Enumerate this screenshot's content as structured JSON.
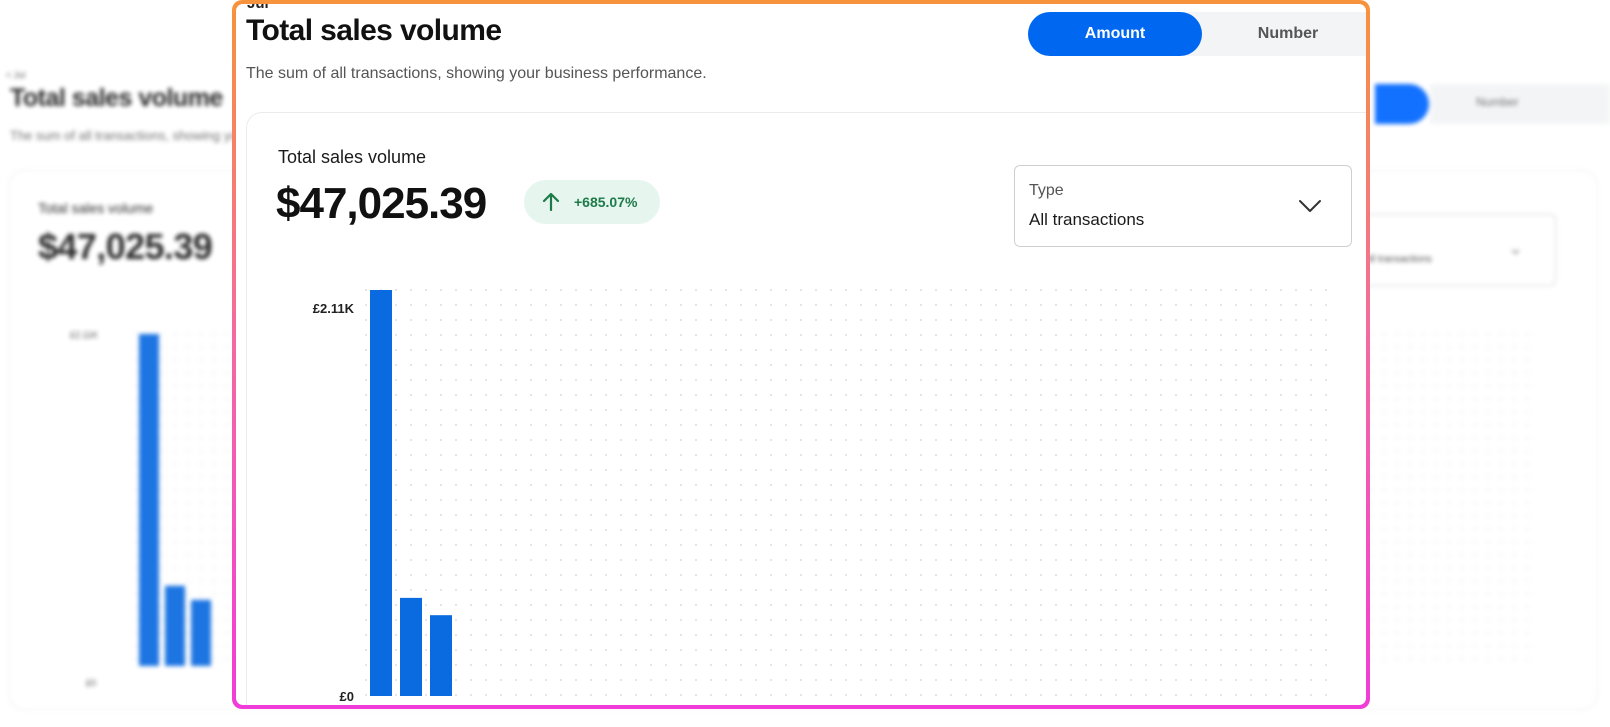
{
  "header": {
    "crumb_fragment": "Jul",
    "title": "Total sales volume",
    "subtitle": "The sum of all transactions, showing your business performance."
  },
  "toggle": {
    "amount_label": "Amount",
    "number_label": "Number",
    "selected": "Amount"
  },
  "summary": {
    "label": "Total sales volume",
    "total": "$47,025.39",
    "change": "+685.07%",
    "change_icon": "arrow-up-icon"
  },
  "type_filter": {
    "label": "Type",
    "value": "All transactions",
    "icon": "chevron-down-icon"
  },
  "background": {
    "crumb": "< Jul",
    "title": "Total sales volume",
    "subtitle": "The sum of all transactions, showing your business performance.",
    "card_label": "Total sales volume",
    "total": "$47,025.39",
    "ymax_label": "£2.11K",
    "ymin_label": "£0",
    "toggle_label": "Number",
    "select_value": "All transactions"
  },
  "colors": {
    "accent": "#0068f0",
    "bar": "#0a6ae0",
    "positive": "#1d7a4a",
    "positive_bg": "#e6f6ee",
    "border_top": "#f7933b",
    "border_bottom": "#f03cd8"
  },
  "chart_data": {
    "type": "bar",
    "title": "",
    "xlabel": "",
    "ylabel": "",
    "ylim": [
      0,
      2110
    ],
    "y_tick_labels": [
      "£2.11K",
      "£0"
    ],
    "values": [
      2110,
      510,
      420
    ],
    "grid": "dotted",
    "slots": 32
  }
}
